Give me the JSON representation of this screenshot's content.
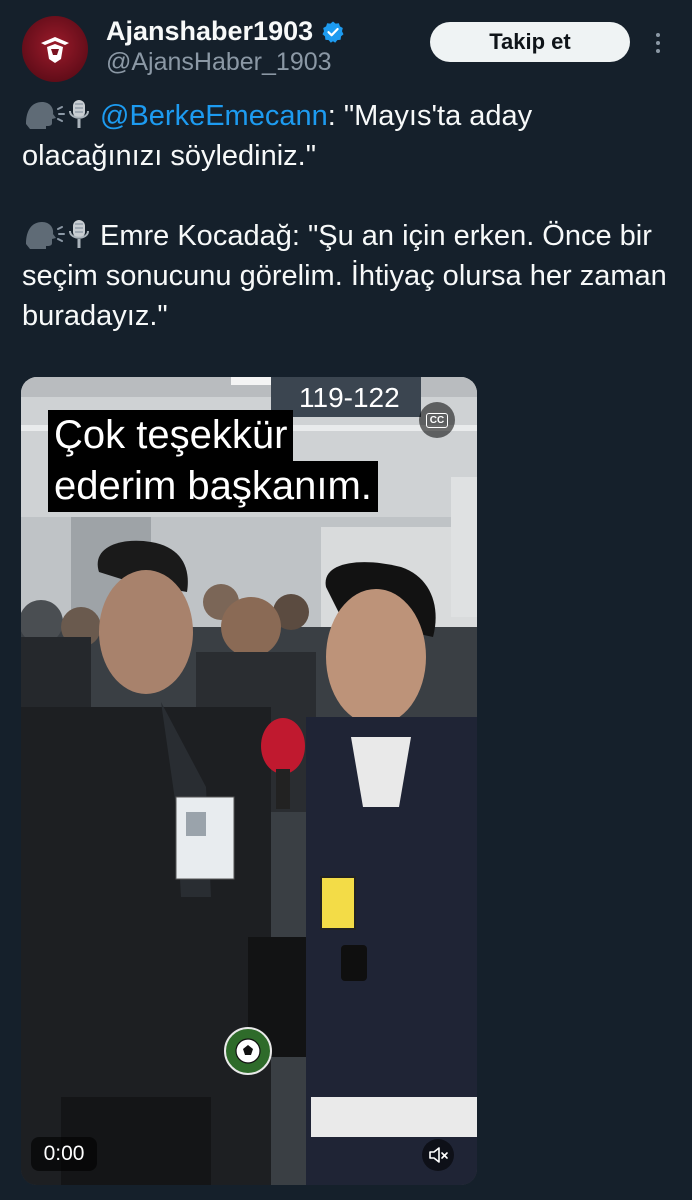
{
  "author": {
    "display_name": "Ajanshaber1903",
    "handle": "@AjansHaber_1903",
    "verified": true,
    "avatar_icon": "eagle-logo-icon"
  },
  "follow_button": {
    "label": "Takip et"
  },
  "more_icon": "more-vertical-icon",
  "tweet": {
    "line1_emoji": "speaking-head-microphone-emoji",
    "line1_mention": "@BerkeEmecann",
    "line1_text": ": \"Mayıs'ta aday olacağınızı söylediniz.\"",
    "line2_emoji": "speaking-head-microphone-emoji",
    "line2_text": "Emre Kocadağ: \"Şu an için erken. Önce bir seçim sonucunu görelim. İhtiyaç olursa her zaman buradayız.\""
  },
  "video": {
    "caption_line1": "Çok teşekkür",
    "caption_line2": "ederim başkanım.",
    "sign_text": "119-122",
    "cc_label": "CC",
    "timestamp": "0:00",
    "muted": true
  },
  "colors": {
    "background": "#15202b",
    "link": "#1d9bf0",
    "muted_text": "#8b98a5",
    "button_bg": "#eff3f4"
  }
}
